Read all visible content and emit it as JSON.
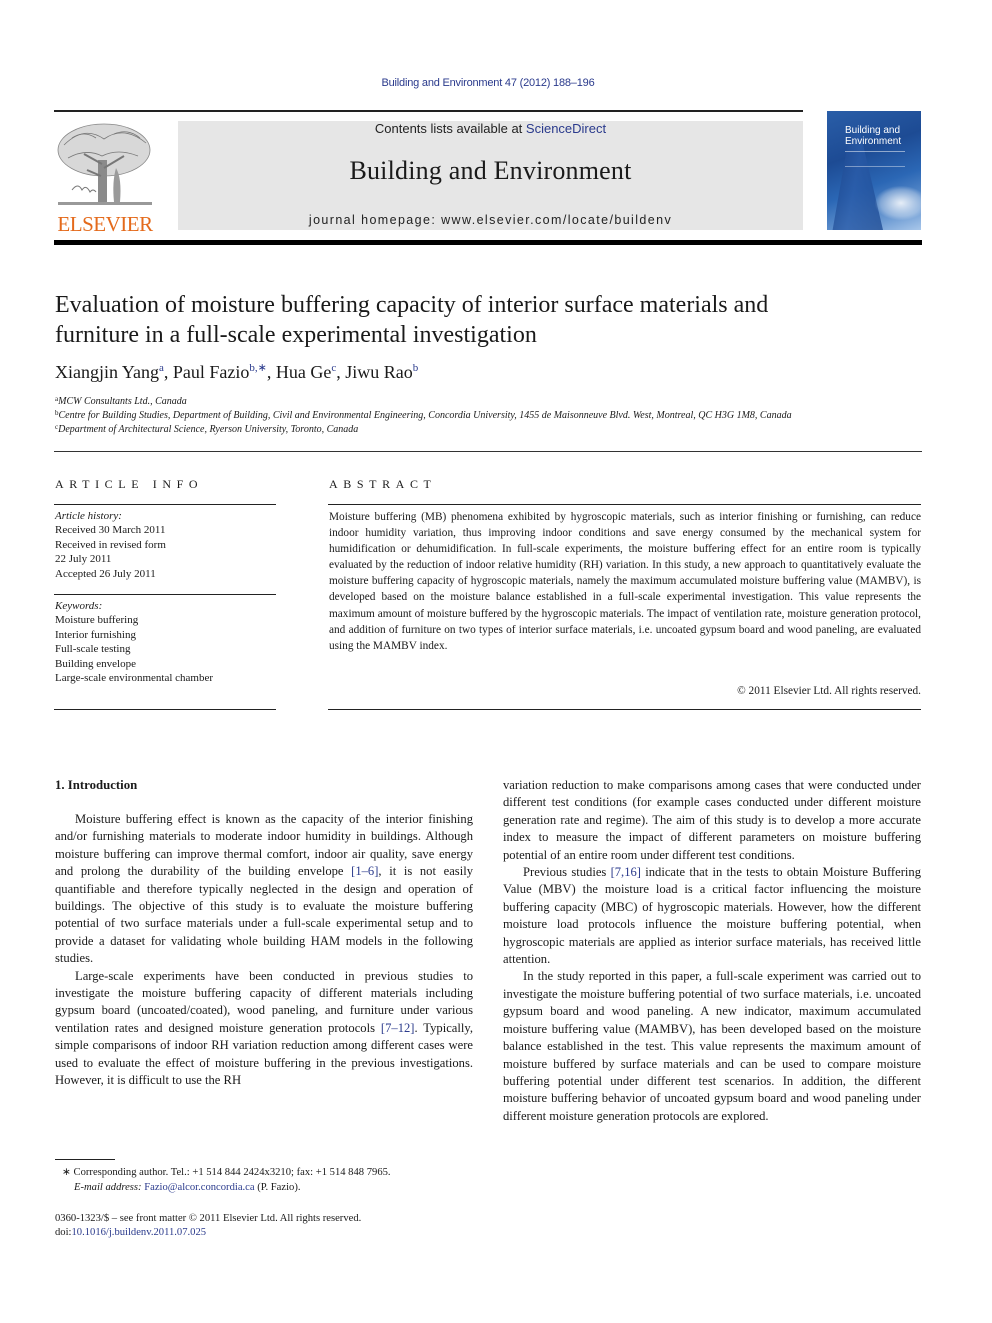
{
  "header": {
    "journal_reference": "Building and Environment 47 (2012) 188–196",
    "contents_prefix": "Contents lists available at ",
    "contents_link": "ScienceDirect",
    "journal_title": "Building and Environment",
    "homepage": "journal homepage: www.elsevier.com/locate/buildenv",
    "publisher_logo_text": "ELSEVIER",
    "cover_title_line1": "Building and",
    "cover_title_line2": "Environment",
    "colors": {
      "publisher_orange": "#e46a1b",
      "link_blue": "#2a3a8c",
      "banner_gray": "#e6e6e6"
    }
  },
  "article": {
    "title_line1": "Evaluation of moisture buffering capacity of interior surface materials and",
    "title_line2": "furniture in a full-scale experimental investigation",
    "authors": [
      {
        "name": "Xiangjin Yang",
        "sup": "a",
        "sep": ", "
      },
      {
        "name": "Paul Fazio",
        "sup": "b,∗",
        "sep": ", "
      },
      {
        "name": "Hua Ge",
        "sup": "c",
        "sep": ", "
      },
      {
        "name": "Jiwu Rao",
        "sup": "b",
        "sep": ""
      }
    ],
    "affiliations": [
      {
        "sup": "a",
        "text": "MCW Consultants Ltd., Canada"
      },
      {
        "sup": "b",
        "text": "Centre for Building Studies, Department of Building, Civil and Environmental Engineering, Concordia University, 1455 de Maisonneuve Blvd. West, Montreal, QC H3G 1M8, Canada"
      },
      {
        "sup": "c",
        "text": "Department of Architectural Science, Ryerson University, Toronto, Canada"
      }
    ]
  },
  "article_info": {
    "heading": "ARTICLE INFO",
    "history_label": "Article history:",
    "history": [
      "Received 30 March 2011",
      "Received in revised form",
      "22 July 2011",
      "Accepted 26 July 2011"
    ],
    "keywords_label": "Keywords:",
    "keywords": [
      "Moisture buffering",
      "Interior furnishing",
      "Full-scale testing",
      "Building envelope",
      "Large-scale environmental chamber"
    ]
  },
  "abstract": {
    "heading": "ABSTRACT",
    "text": "Moisture buffering (MB) phenomena exhibited by hygroscopic materials, such as interior finishing or furnishing, can reduce indoor humidity variation, thus improving indoor conditions and save energy consumed by the mechanical system for humidification or dehumidification. In full-scale experiments, the moisture buffering effect for an entire room is typically evaluated by the reduction of indoor relative humidity (RH) variation. In this study, a new approach to quantitatively evaluate the moisture buffering capacity of hygroscopic materials, namely the maximum accumulated moisture buffering value (MAMBV), is developed based on the moisture balance established in a full-scale experimental investi­gation. This value represents the maximum amount of moisture buffered by the hygroscopic materials. The impact of ventilation rate, moisture generation protocol, and addition of furniture on two types of interior surface materials, i.e. uncoated gypsum board and wood paneling, are evaluated using the MAMBV index.",
    "copyright": "© 2011 Elsevier Ltd. All rights reserved."
  },
  "introduction": {
    "heading": "1.  Introduction",
    "left_col": [
      {
        "before": "Moisture buffering effect is known as the capacity of the interior finishing and/or furnishing materials to moderate indoor humidity in buildings. Although moisture buffering can improve thermal comfort, indoor air quality, save energy and prolong the durability of the building envelope ",
        "ref": "[1–6]",
        "after": ", it is not easily quantifiable and therefore typically neglected in the design and operation of buildings. The objective of this study is to evaluate the moisture buffering potential of two surface materials under a full-scale experimental setup and to provide a dataset for validating whole building HAM models in the following studies."
      },
      {
        "before": "Large-scale experiments have been conducted in previous studies to investigate the moisture buffering capacity of different materials including gypsum board (uncoated/coated), wood paneling, and furniture under various ventilation rates and designed moisture generation protocols ",
        "ref": "[7–12]",
        "after": ". Typically, simple comparisons of indoor RH variation reduction among different cases were used to evaluate the effect of moisture buffering in the previous investigations. However, it is difficult to use the RH"
      }
    ],
    "right_col": [
      {
        "before": "variation reduction to make comparisons among cases that were conducted under different test conditions (for example cases con­ducted under different moisture generation rate and regime). The aim of this study is to develop a more accurate index to measure the impact of different parameters on moisture buffering potential of an entire room under different test conditions.",
        "ref": "",
        "after": ""
      },
      {
        "before": "Previous studies ",
        "ref": "[7,16]",
        "after": " indicate that in the tests to obtain Moisture Buffering Value (MBV) the moisture load is a critical factor influencing the moisture buffering capacity (MBC) of hygroscopic materials. However, how the different moisture load protocols influence the moisture buffering potential, when hygroscopic materials are applied as interior surface materials, has received little attention."
      },
      {
        "before": "In the study reported in this paper, a full-scale experiment was carried out to investigate the moisture buffering potential of two surface materials, i.e. uncoated gypsum board and wood paneling. A new indicator, maximum accumulated moisture buffering value (MAMBV), has been developed based on the moisture balance established in the test. This value represents the maximum amount of moisture buffered by surface materials and can be used to compare moisture buffering potential under different test scenarios. In addition, the different moisture buffering behavior of uncoated gypsum board and wood paneling under different moisture generation protocols are explored.",
        "ref": "",
        "after": ""
      }
    ]
  },
  "footnotes": {
    "corresponding": "∗  Corresponding author. Tel.: +1 514 844 2424x3210; fax: +1 514 848 7965.",
    "email_label": "E-mail address: ",
    "email": "Fazio@alcor.concordia.ca",
    "email_suffix": " (P. Fazio).",
    "front_matter": "0360-1323/$ – see front matter © 2011 Elsevier Ltd. All rights reserved.",
    "doi_label": "doi:",
    "doi": "10.1016/j.buildenv.2011.07.025"
  }
}
